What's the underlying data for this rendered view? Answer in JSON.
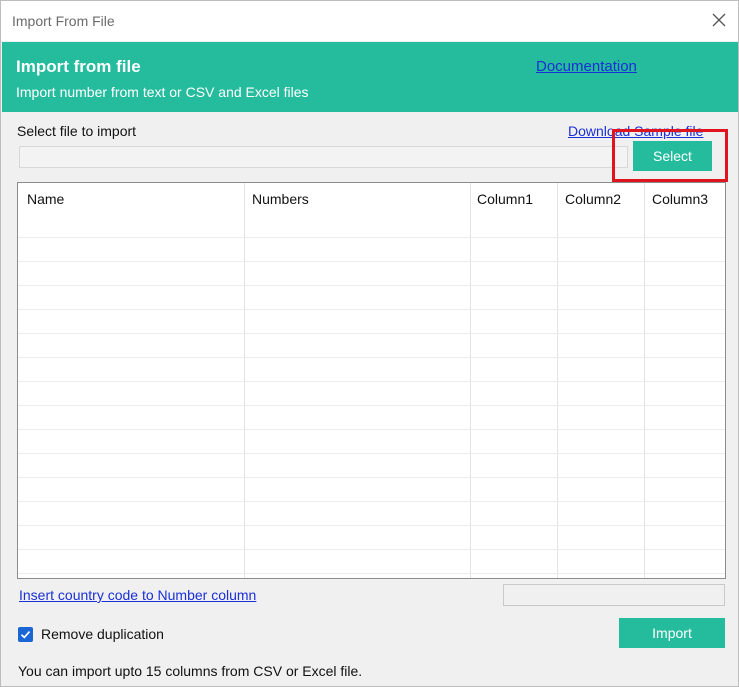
{
  "window": {
    "title": "Import From File"
  },
  "header": {
    "title": "Import from file",
    "subtitle": "Import number from text or CSV and Excel files",
    "doc_link": "Documentation"
  },
  "file": {
    "label": "Select file to import",
    "sample_link": "Download Sample file",
    "path_value": "",
    "select_label": "Select"
  },
  "table": {
    "columns": [
      "Name",
      "Numbers",
      "Column1",
      "Column2",
      "Column3"
    ],
    "rows": []
  },
  "country_code_link": "Insert country code to Number column",
  "remove_duplication": {
    "label": "Remove duplication",
    "checked": true
  },
  "import_label": "Import",
  "footnote": "You can import upto 15 columns from CSV or Excel file.",
  "colors": {
    "accent": "#25bc9d",
    "link": "#1a2fd6",
    "highlight": "#e0141e",
    "checkbox": "#1a66d4"
  }
}
